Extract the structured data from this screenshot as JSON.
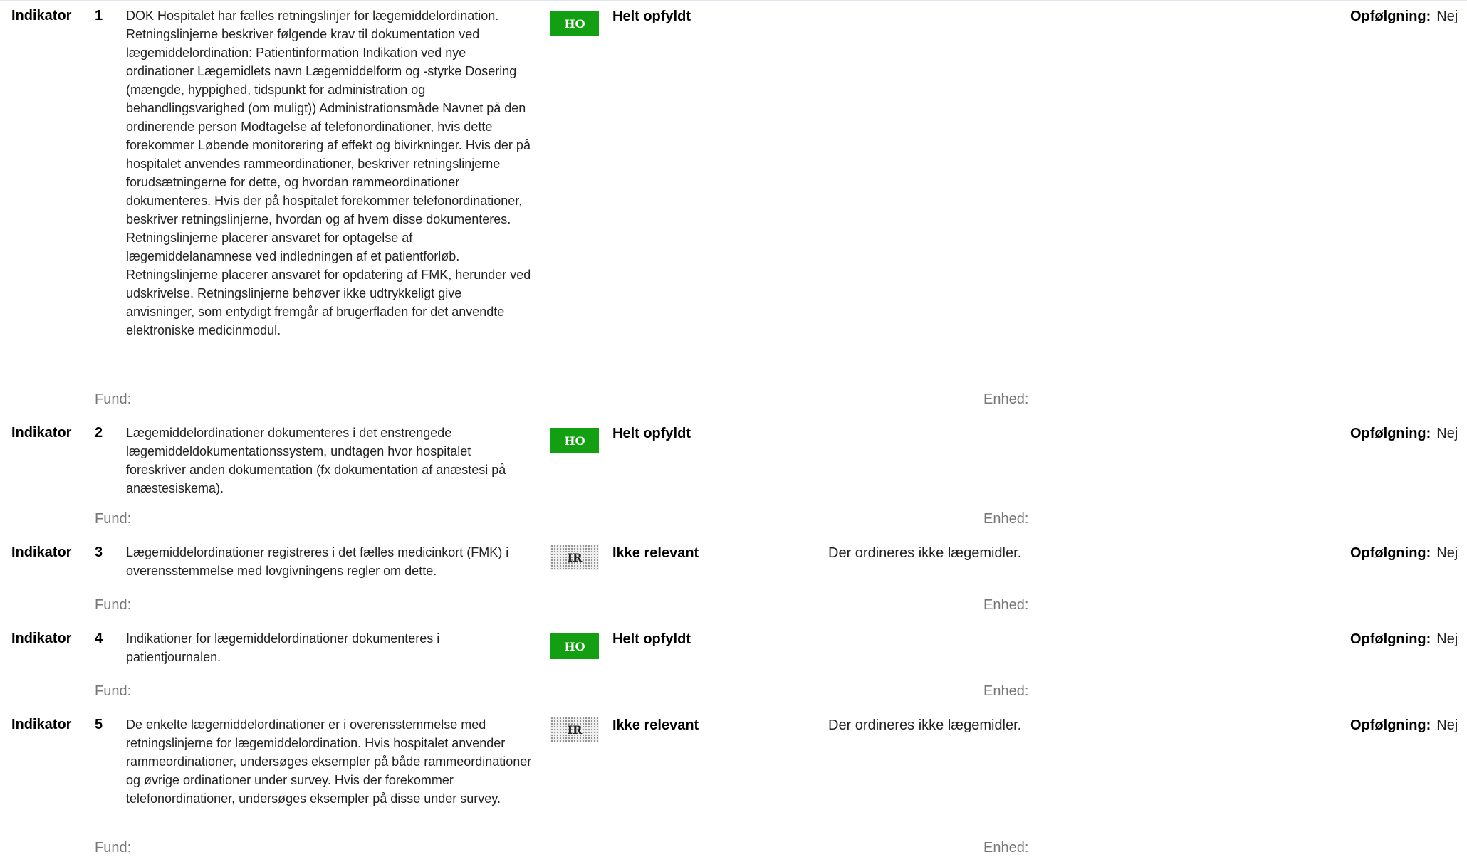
{
  "indicators": [
    {
      "label": "Indikator",
      "number": "1",
      "description": "DOK Hospitalet har fælles retningslinjer for lægemiddelordination. Retningslinjerne beskriver følgende krav til dokumentation ved lægemiddelordination: Patientinformation Indikation ved nye ordinationer Lægemidlets navn Lægemiddelform og -styrke Dosering (mængde, hyppighed, tidspunkt for administration og behandlingsvarighed (om muligt)) Administrationsmåde  Navnet på den ordinerende person Modtagelse af telefonordinationer, hvis dette forekommer Løbende monitorering af effekt og bivirkninger.  Hvis der på hospitalet anvendes rammeordinationer, beskriver retningslinjerne forudsætningerne for dette, og hvordan rammeordinationer dokumenteres.   Hvis der på hospitalet forekommer telefonordinationer, beskriver retningslinjerne, hvordan og af hvem disse dokumenteres.   Retningslinjerne placerer ansvaret for optagelse af lægemiddelanamnese ved indledningen af et patientforløb.   Retningslinjerne placerer ansvaret for opdatering af FMK, herunder ved udskrivelse. Retningslinjerne behøver ikke udtrykkeligt give anvisninger, som entydigt fremgår af brugerfladen for det anvendte elektroniske medicinmodul.",
      "badge": "HO",
      "status": "Helt opfyldt",
      "comment": "",
      "followup_label": "Opfølgning:",
      "followup_value": "Nej",
      "fund_label": "Fund:",
      "enhed_label": "Enhed:"
    },
    {
      "label": "Indikator",
      "number": "2",
      "description": "Lægemiddelordinationer dokumenteres i det enstrengede lægemiddeldokumentationssystem, undtagen hvor hospitalet foreskriver anden dokumentation (fx dokumentation af anæstesi på anæstesiskema).",
      "badge": "HO",
      "status": "Helt opfyldt",
      "comment": "",
      "followup_label": "Opfølgning:",
      "followup_value": "Nej",
      "fund_label": "Fund:",
      "enhed_label": "Enhed:"
    },
    {
      "label": "Indikator",
      "number": "3",
      "description": "Lægemiddelordinationer registreres i det fælles medicinkort (FMK) i overensstemmelse med lovgivningens regler om dette.",
      "badge": "IR",
      "status": "Ikke relevant",
      "comment": "Der ordineres ikke lægemidler.",
      "followup_label": "Opfølgning:",
      "followup_value": "Nej",
      "fund_label": "Fund:",
      "enhed_label": "Enhed:"
    },
    {
      "label": "Indikator",
      "number": "4",
      "description": "Indikationer for lægemiddelordinationer dokumenteres i patientjournalen.",
      "badge": "HO",
      "status": "Helt opfyldt",
      "comment": "",
      "followup_label": "Opfølgning:",
      "followup_value": "Nej",
      "fund_label": "Fund:",
      "enhed_label": "Enhed:"
    },
    {
      "label": "Indikator",
      "number": "5",
      "description": "De enkelte lægemiddelordinationer er i overensstemmelse med retningslinjerne for lægemiddelordination.   Hvis hospitalet anvender rammeordinationer, undersøges eksempler på både rammeordinationer og øvrige ordinationer under survey.   Hvis der forekommer telefonordinationer, undersøges eksempler på disse under survey.",
      "badge": "IR",
      "status": "Ikke relevant",
      "comment": "Der ordineres ikke lægemidler.",
      "followup_label": "Opfølgning:",
      "followup_value": "Nej",
      "fund_label": "Fund:",
      "enhed_label": "Enhed:"
    }
  ],
  "colors": {
    "ho_badge": "#12a012",
    "ir_badge": "#efefef",
    "muted_text": "#777777"
  }
}
